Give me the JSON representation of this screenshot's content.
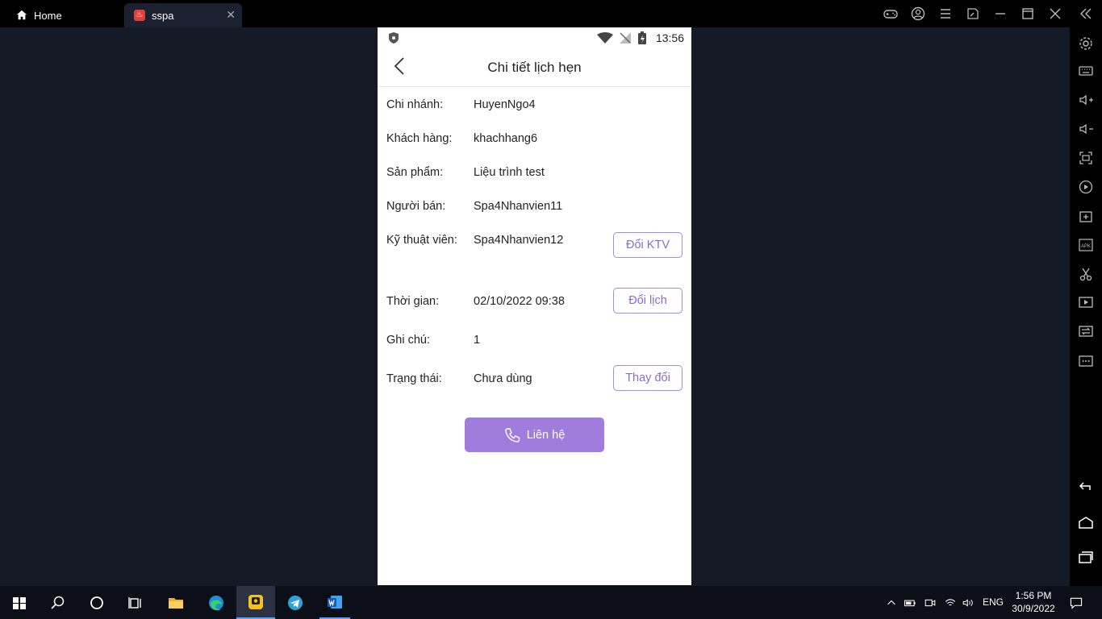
{
  "window": {
    "tabs": [
      {
        "label": "Home"
      },
      {
        "label": "sspa"
      }
    ]
  },
  "phone": {
    "status_time": "13:56",
    "title": "Chi tiết lịch hẹn",
    "rows": [
      {
        "label": "Chi nhánh:",
        "value": "HuyenNgo4"
      },
      {
        "label": "Khách hàng:",
        "value": "khachhang6"
      },
      {
        "label": "Sản phẩm:",
        "value": "Liệu trình test"
      },
      {
        "label": "Người bán:",
        "value": "Spa4Nhanvien11"
      },
      {
        "label": "Kỹ thuật viên:",
        "value": "Spa4Nhanvien12"
      },
      {
        "label": "Thời gian:",
        "value": "02/10/2022 09:38"
      },
      {
        "label": "Ghi chú:",
        "value": "1"
      },
      {
        "label": "Trạng thái:",
        "value": "Chưa dùng"
      }
    ],
    "buttons": {
      "change_technician": "Đổi KTV",
      "reschedule": "Đổi lịch",
      "change_status": "Thay đổi",
      "contact": "Liên hệ"
    },
    "accent_color": "#a07ddc"
  },
  "taskbar": {
    "language": "ENG",
    "time": "1:56 PM",
    "date": "30/9/2022"
  }
}
